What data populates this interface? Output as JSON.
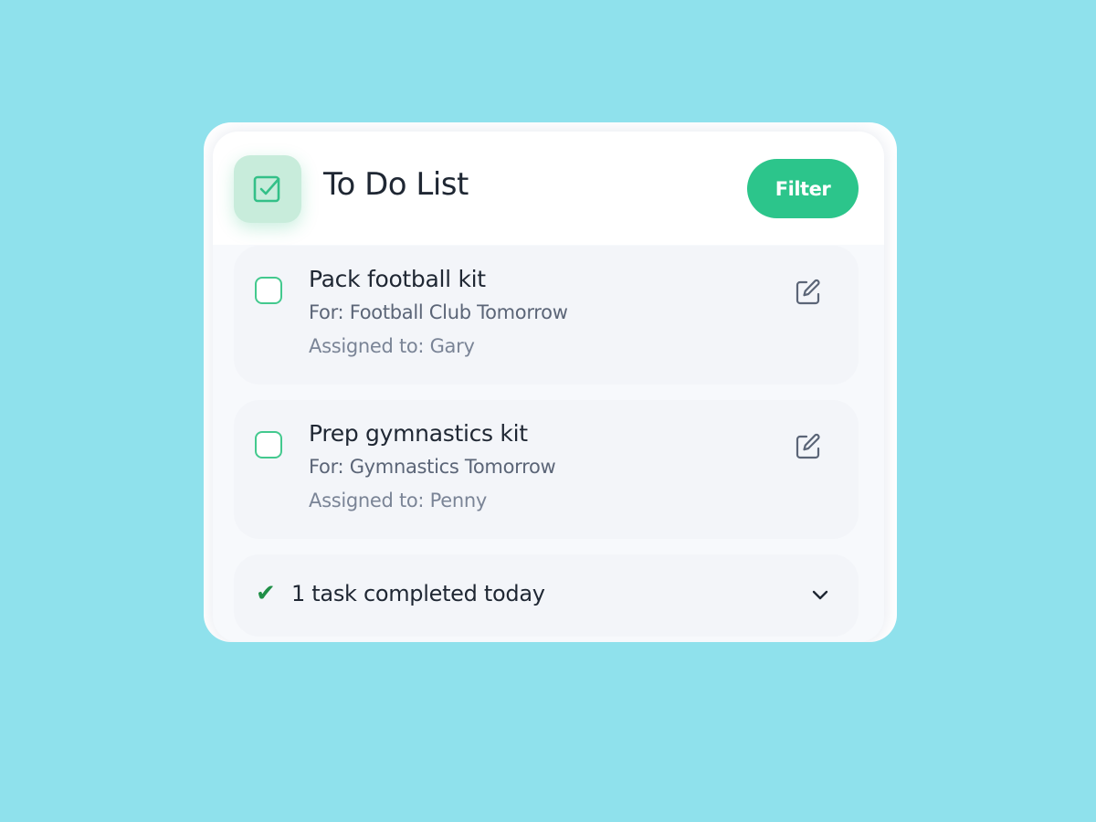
{
  "header": {
    "app_icon": "checkbox-checked-icon",
    "title": "To Do List",
    "filter_label": "Filter"
  },
  "tasks": [
    {
      "title": "Pack football kit",
      "for": "For: Football Club Tomorrow",
      "assigned": "Assigned to: Gary",
      "checked": false
    },
    {
      "title": "Prep gymnastics kit",
      "for": "For: Gymnastics Tomorrow",
      "assigned": "Assigned to: Penny",
      "checked": false
    }
  ],
  "completed": {
    "check": "✔",
    "label": "1 task completed today",
    "icon": "chevron-down-icon"
  },
  "colors": {
    "background": "#8fe1ec",
    "accent": "#2cc58b",
    "check_green": "#1f8f47"
  }
}
